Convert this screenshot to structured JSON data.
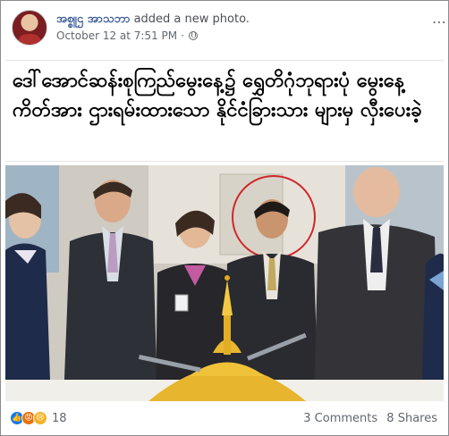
{
  "post": {
    "author": "အစ္စူဌ အာသဘာ",
    "action": "added a new photo.",
    "timestamp": "October 12 at 7:51 PM",
    "separator": "·",
    "privacy_icon": "globe-icon",
    "more_icon": "ellipsis-icon"
  },
  "caption": "ဒေါ်အောင်ဆန်းစုကြည်မွေးနေ့၌ ရွှေတိဂုံဘုရားပုံ မွေးနေ့ကိတ်အား ဌားရမ်းထားသော နိုင်ငံခြားသား များမှ လှီးပေးခဲ့",
  "reactions": {
    "icons": [
      "like-icon",
      "angry-icon",
      "sad-icon"
    ],
    "count": "18"
  },
  "engagement": {
    "comments": "3 Comments",
    "shares": "8 Shares"
  },
  "colors": {
    "author": "#385898",
    "like": "#1877f2",
    "circle_highlight": "#d0262a"
  }
}
